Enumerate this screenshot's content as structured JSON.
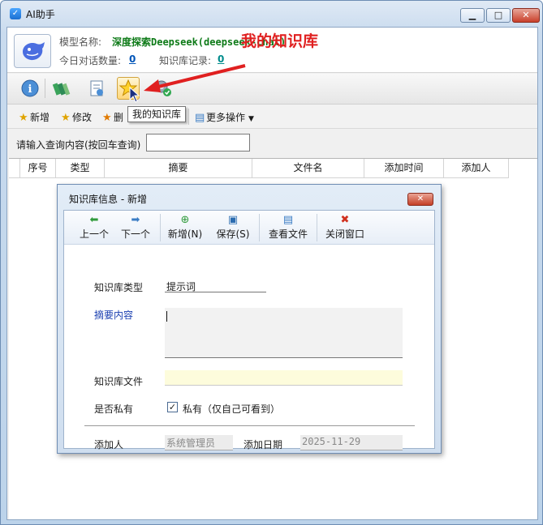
{
  "window": {
    "title": "AI助手",
    "icon": "app-logo-icon",
    "controls": [
      "minimize-icon",
      "maximize-icon",
      "close-icon"
    ]
  },
  "info": {
    "model_label": "模型名称:",
    "model_value": "深度探索Deepseek(deepseek-chat)",
    "dialog_count_label": "今日对话数量:",
    "dialog_count_value": "0",
    "kb_records_label": "知识库记录:",
    "kb_records_value": "0"
  },
  "annotation": "我的知识库",
  "iconbar": {
    "tooltip": "我的知识库",
    "icons": [
      "info-icon",
      "books-icon",
      "document-icon",
      "star-icon",
      "settings-check-icon"
    ]
  },
  "actions": {
    "add": "新增",
    "edit": "修改",
    "delete": "删",
    "more": "更多操作"
  },
  "search": {
    "label": "请输入查询内容(按回车查询)",
    "value": ""
  },
  "grid": {
    "columns": [
      "序号",
      "类型",
      "摘要",
      "文件名",
      "添加时间",
      "添加人"
    ]
  },
  "dialog": {
    "title": "知识库信息 - 新增",
    "tools": {
      "prev": "上一个",
      "next": "下一个",
      "new": "新增(N)",
      "save": "保存(S)",
      "view_file": "查看文件",
      "close": "关闭窗口"
    },
    "fields": {
      "type_label": "知识库类型",
      "type_value": "提示词",
      "summary_label": "摘要内容",
      "summary_value": "",
      "file_label": "知识库文件",
      "file_value": "",
      "private_label": "是否私有",
      "private_checked": true,
      "private_text": "私有（仅自己可看到）",
      "adder_label": "添加人",
      "adder_value": "系统管理员",
      "date_label": "添加日期",
      "date_value": "2025-11-29"
    }
  },
  "colors": {
    "model_value": "#0d7a17",
    "count_value": "#0055b8",
    "records_value": "#008c8c",
    "annotation": "#e02020",
    "summary_label": "#1a3fb0",
    "file_field_bg": "#fdfcdc"
  }
}
